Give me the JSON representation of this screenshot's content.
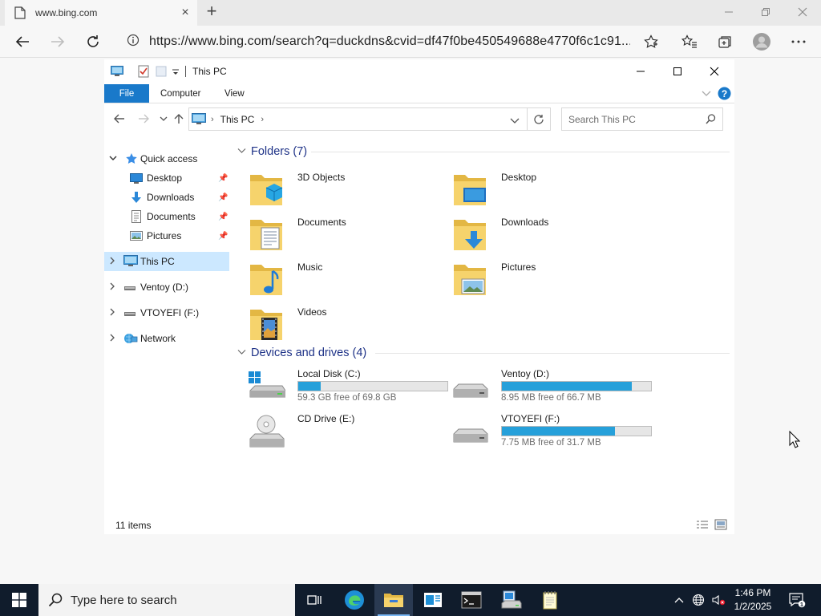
{
  "browser": {
    "tab_title": "www.bing.com",
    "tab_close": "×",
    "new_tab": "+",
    "url": "https://www.bing.com/search?q=duckdns&cvid=df47f0be450549688e4770f6c1c91..."
  },
  "explorer": {
    "window_title": "This PC",
    "ribbon": {
      "file": "File",
      "computer": "Computer",
      "view": "View"
    },
    "breadcrumb": {
      "location": "This PC"
    },
    "search_placeholder": "Search This PC",
    "nav": {
      "quick_access": "Quick access",
      "desktop": "Desktop",
      "downloads": "Downloads",
      "documents": "Documents",
      "pictures": "Pictures",
      "this_pc": "This PC",
      "ventoy": "Ventoy (D:)",
      "vtoyefi": "VTOYEFI (F:)",
      "network": "Network"
    },
    "folders_header": "Folders (7)",
    "folders": {
      "objects3d": "3D Objects",
      "desktop": "Desktop",
      "documents": "Documents",
      "downloads": "Downloads",
      "music": "Music",
      "pictures": "Pictures",
      "videos": "Videos"
    },
    "drives_header": "Devices and drives (4)",
    "drives": {
      "c": {
        "name": "Local Disk (C:)",
        "free": "59.3 GB free of 69.8 GB",
        "used_fraction": 0.15
      },
      "d": {
        "name": "Ventoy (D:)",
        "free": "8.95 MB free of 66.7 MB",
        "used_fraction": 0.87
      },
      "e": {
        "name": "CD Drive (E:)"
      },
      "f": {
        "name": "VTOYEFI (F:)",
        "free": "7.75 MB free of 31.7 MB",
        "used_fraction": 0.76
      }
    },
    "status": "11 items"
  },
  "taskbar": {
    "search_placeholder": "Type here to search",
    "time": "1:46 PM",
    "date": "1/2/2025",
    "notification_count": "1"
  },
  "colors": {
    "accent": "#1979ca",
    "progress": "#26a0da",
    "selection": "#cce8ff",
    "group_header": "#1e3287",
    "taskbar": "#101c2c"
  }
}
